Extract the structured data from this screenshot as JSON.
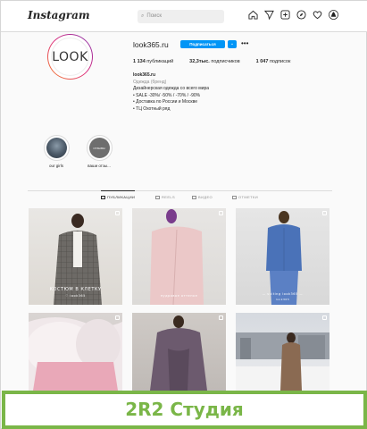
{
  "topnav": {
    "logo": "Instagram",
    "search_placeholder": "Поиск",
    "icons": [
      "home-icon",
      "direct-icon",
      "new-post-icon",
      "explore-icon",
      "activity-icon",
      "profile-avatar"
    ]
  },
  "profile": {
    "avatar_text": "LOOK",
    "username": "look365.ru",
    "follow_label": "Подписаться",
    "more_label": "•••",
    "stats": {
      "posts": "1 134",
      "posts_label": "публикаций",
      "followers": "32,3тыс.",
      "followers_label": "подписчиков",
      "following": "1 047",
      "following_label": "подписок"
    },
    "bio": {
      "name": "look365.ru",
      "category": "Одежда (бренд)",
      "line1": "Дизайнерская одежда со всего мира",
      "line2": "• SALE -30%/ -50% / -70% / -90%",
      "line3": "• Доставка по России и Москве",
      "line4": "• ТЦ Охотный ряд"
    }
  },
  "highlights": [
    {
      "label": "our girls"
    },
    {
      "label": "ваши отзы...",
      "inner_text": "ОТЗЫВЫ"
    }
  ],
  "tabs": [
    {
      "label": "ПУБЛИКАЦИИ",
      "active": true
    },
    {
      "label": "REELS",
      "active": false
    },
    {
      "label": "ВИДЕО",
      "active": false
    },
    {
      "label": "ОТМЕТКИ",
      "active": false
    }
  ],
  "posts": [
    {
      "caption": "КОСТЮМ В КЛЕТКУ",
      "caption2": "♡ look365"
    },
    {
      "caption": "пудровое оттенке",
      "caption2": ""
    },
    {
      "caption": "— suiting look365 —",
      "caption2": "look365"
    },
    {
      "caption": "",
      "caption2": ""
    },
    {
      "caption": "",
      "caption2": ""
    },
    {
      "caption": "",
      "caption2": ""
    }
  ],
  "banner": {
    "text": "2R2 Студия"
  },
  "colors": {
    "accent": "#0095f6",
    "banner_green": "#7ab648"
  }
}
